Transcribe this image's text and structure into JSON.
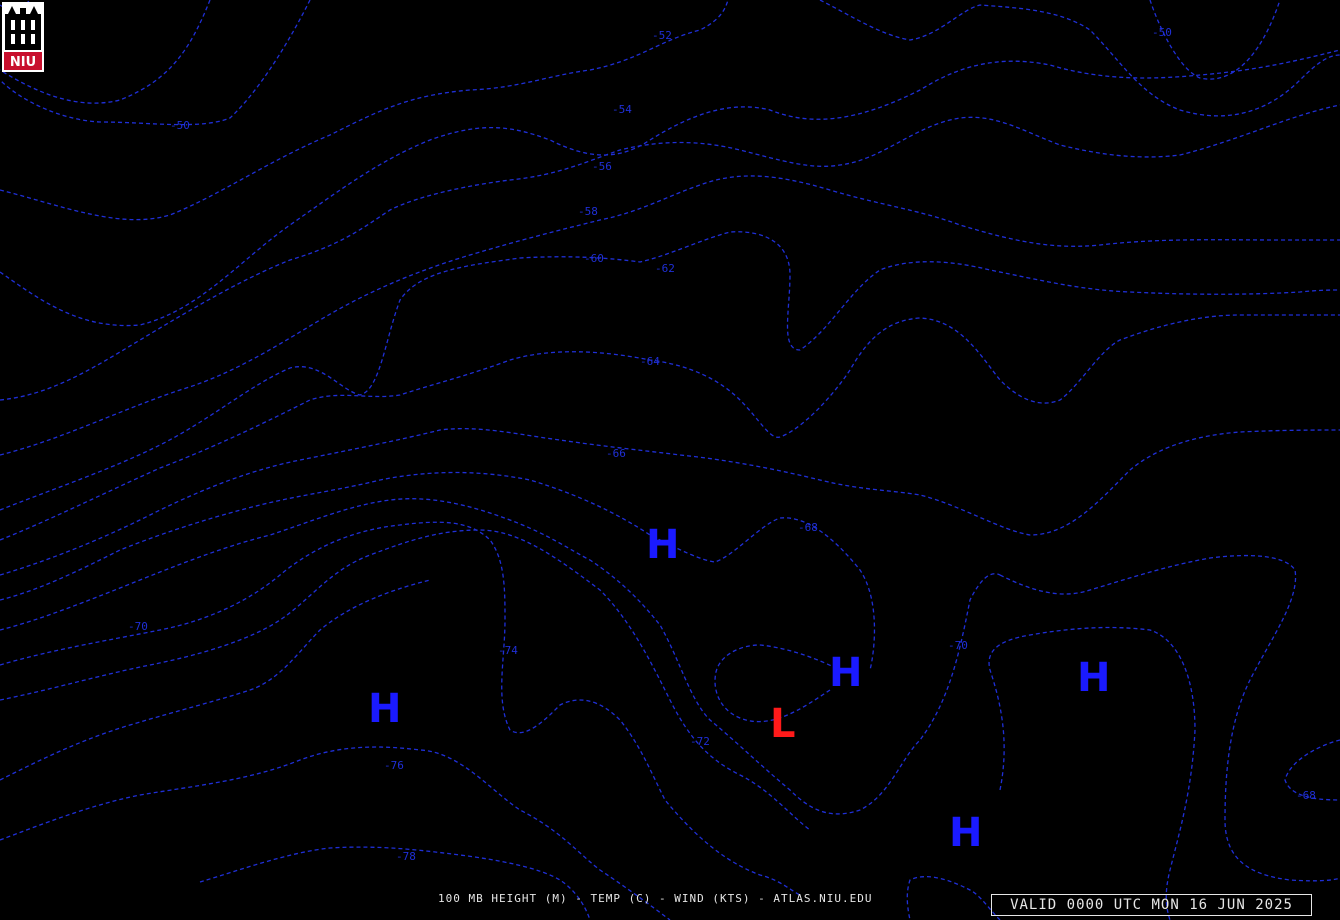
{
  "caption": "100 MB HEIGHT (M) - TEMP (C) - WIND (KTS) - ATLAS.NIU.EDU",
  "valid": "VALID 0000 UTC MON 16 JUN 2025",
  "logo_text": "NIU",
  "colors": {
    "background": "#000000",
    "isotherm": "#1f2fd6",
    "high": "#1a1aff",
    "low": "#ff1a1a",
    "text": "#e6e6e6"
  },
  "contour_labels": [
    "-52",
    "-50",
    "-50",
    "-54",
    "-56",
    "-58",
    "-60",
    "-62",
    "-64",
    "-66",
    "-68",
    "-70",
    "-70",
    "-72",
    "-74",
    "-76",
    "-78",
    "-68"
  ],
  "pressure_centers": [
    "H",
    "H",
    "H",
    "H",
    "H",
    "L"
  ]
}
